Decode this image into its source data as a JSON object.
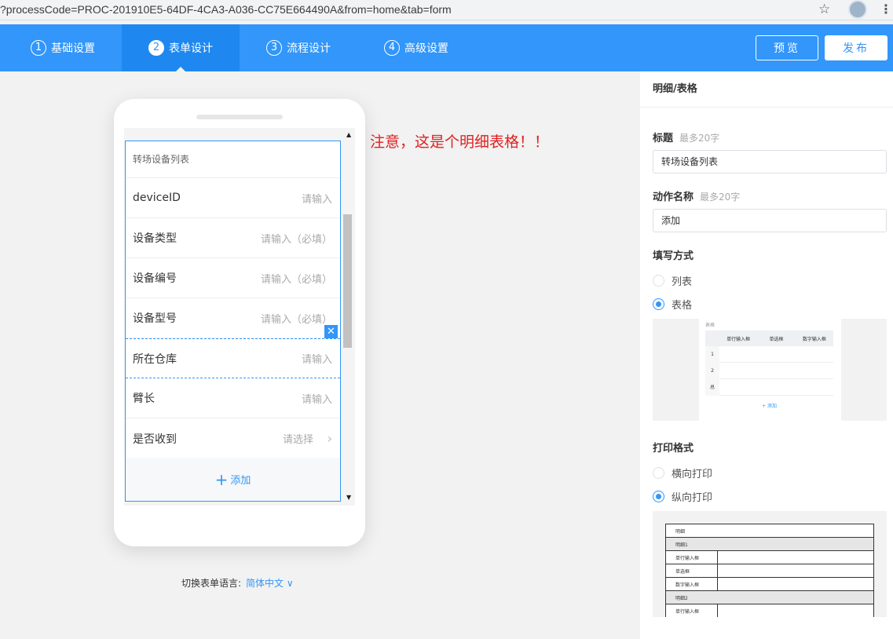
{
  "browser": {
    "url": "?processCode=PROC-201910E5-64DF-4CA3-A036-CC75E664490A&from=home&tab=form"
  },
  "steps": [
    {
      "num": "1",
      "label": "基础设置"
    },
    {
      "num": "2",
      "label": "表单设计"
    },
    {
      "num": "3",
      "label": "流程设计"
    },
    {
      "num": "4",
      "label": "高级设置"
    }
  ],
  "toolbar": {
    "preview_label": "预览",
    "publish_label": "发布"
  },
  "phone": {
    "detail_title": "转场设备列表",
    "fields": [
      {
        "label": "deviceID",
        "placeholder": "请输入"
      },
      {
        "label": "设备类型",
        "placeholder": "请输入（必填）"
      },
      {
        "label": "设备编号",
        "placeholder": "请输入（必填）"
      },
      {
        "label": "设备型号",
        "placeholder": "请输入（必填）"
      },
      {
        "label": "所在仓库",
        "placeholder": "请输入"
      },
      {
        "label": "臂长",
        "placeholder": "请输入"
      },
      {
        "label": "是否收到",
        "placeholder": "请选择"
      }
    ],
    "add_label": "添加"
  },
  "note": "注意，这是个明细表格！！",
  "language": {
    "label": "切换表单语言:",
    "value": "简体中文"
  },
  "panel": {
    "title": "明细/表格",
    "title_label": "标题",
    "title_hint": "最多20字",
    "title_value": "转场设备列表",
    "action_label": "动作名称",
    "action_hint": "最多20字",
    "action_value": "添加",
    "fill_label": "填写方式",
    "fill_options": [
      "列表",
      "表格"
    ],
    "fill_selected": "表格",
    "print_label": "打印格式",
    "print_options": [
      "横向打印",
      "纵向打印"
    ],
    "print_selected": "纵向打印",
    "preview_table": {
      "caption": "表格",
      "headers": [
        "单行输入框",
        "单选框",
        "数字输入框"
      ],
      "rows": [
        "1",
        "2",
        "总"
      ],
      "add": "+ 添加"
    },
    "preview_print": {
      "rows": [
        "明细",
        "明细1",
        "单行输入框",
        "单选框",
        "数字输入框",
        "明细2",
        "单行输入框"
      ]
    }
  },
  "colors": {
    "primary": "#3296fa",
    "note": "#e02020"
  }
}
